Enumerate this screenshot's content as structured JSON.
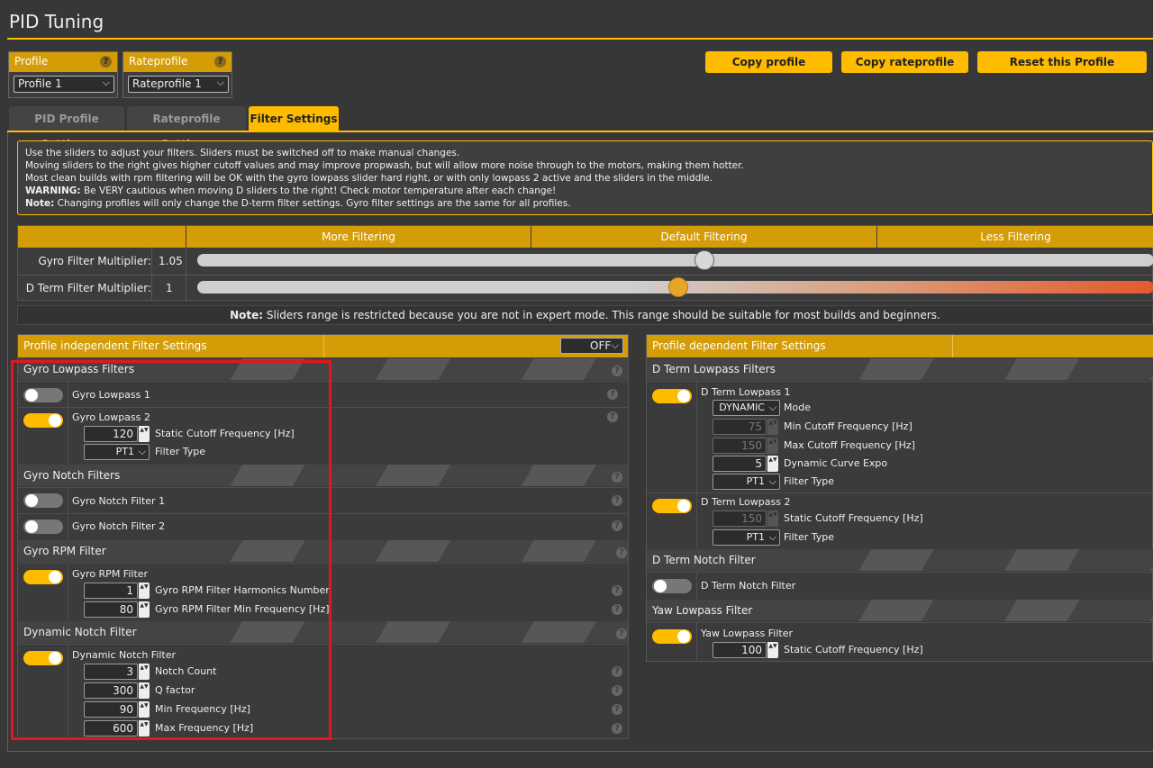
{
  "page_title": "PID Tuning",
  "profile": {
    "label": "Profile",
    "value": "Profile 1"
  },
  "rateprofile": {
    "label": "Rateprofile",
    "value": "Rateprofile 1"
  },
  "buttons": {
    "copy_profile": "Copy profile",
    "copy_rateprofile": "Copy rateprofile",
    "reset_profile": "Reset this Profile"
  },
  "tabs": [
    "PID Profile Settings",
    "Rateprofile Settings",
    "Filter Settings"
  ],
  "note": {
    "line1": "Use the sliders to adjust your filters. Sliders must be switched off to make manual changes.",
    "line2": "Moving sliders to the right gives higher cutoff values and may improve propwash, but will allow more noise through to the motors, making them hotter.",
    "line3": "Most clean builds with rpm filtering will be OK with the gyro lowpass slider hard right, or with only lowpass 2 active and the sliders in the middle.",
    "line4_bold": "WARNING:",
    "line4": " Be VERY cautious when moving D sliders to the right! Check motor temperature after each change!",
    "line5_bold": "Note:",
    "line5": " Changing profiles will only change the D-term filter settings. Gyro filter settings are the same for all profiles."
  },
  "sliders": {
    "headers": [
      "More Filtering",
      "Default Filtering",
      "Less Filtering"
    ],
    "gyro": {
      "label": "Gyro Filter Multiplier:",
      "value": "1.05",
      "position": 0.53
    },
    "dterm": {
      "label": "D Term Filter Multiplier:",
      "value": "1",
      "position": 0.5
    }
  },
  "restrict_note": {
    "bold": "Note:",
    "text": " Sliders range is restricted because you are not in expert mode. This range should be suitable for most builds and beginners."
  },
  "left_panel": {
    "title": "Profile independent Filter Settings",
    "mode": "OFF",
    "gyro_lowpass": {
      "title": "Gyro Lowpass Filters",
      "lp1": "Gyro Lowpass 1",
      "lp2": "Gyro Lowpass 2",
      "lp2_cutoff": "120",
      "lp2_cutoff_label": "Static Cutoff Frequency [Hz]",
      "lp2_type": "PT1",
      "lp2_type_label": "Filter Type"
    },
    "gyro_notch": {
      "title": "Gyro Notch Filters",
      "n1": "Gyro Notch Filter 1",
      "n2": "Gyro Notch Filter 2"
    },
    "gyro_rpm": {
      "title": "Gyro RPM Filter",
      "label": "Gyro RPM Filter",
      "harmonics": "1",
      "harmonics_label": "Gyro RPM Filter Harmonics Number",
      "minfreq": "80",
      "minfreq_label": "Gyro RPM Filter Min Frequency [Hz]"
    },
    "dyn_notch": {
      "title": "Dynamic Notch Filter",
      "label": "Dynamic Notch Filter",
      "count": "3",
      "count_label": "Notch Count",
      "q": "300",
      "q_label": "Q factor",
      "min": "90",
      "min_label": "Min Frequency [Hz]",
      "max": "600",
      "max_label": "Max Frequency [Hz]"
    }
  },
  "right_panel": {
    "title": "Profile dependent Filter Settings",
    "dterm_lowpass": {
      "title": "D Term Lowpass Filters",
      "lp1": "D Term Lowpass 1",
      "mode": "DYNAMIC",
      "mode_label": "Mode",
      "min": "75",
      "min_label": "Min Cutoff Frequency [Hz]",
      "max": "150",
      "max_label": "Max Cutoff Frequency [Hz]",
      "expo": "5",
      "expo_label": "Dynamic Curve Expo",
      "type": "PT1",
      "type_label": "Filter Type",
      "lp2": "D Term Lowpass 2",
      "lp2_cutoff": "150",
      "lp2_cutoff_label": "Static Cutoff Frequency [Hz]",
      "lp2_type": "PT1",
      "lp2_type_label": "Filter Type"
    },
    "dterm_notch": {
      "title": "D Term Notch Filter",
      "label": "D Term Notch Filter"
    },
    "yaw_lowpass": {
      "title": "Yaw Lowpass Filter",
      "label": "Yaw Lowpass Filter",
      "cutoff": "100",
      "cutoff_label": "Static Cutoff Frequency [Hz]"
    }
  },
  "icons": {
    "help": "?",
    "chevron": "⌵",
    "spinner": "▲▼"
  },
  "colors": {
    "accent": "#ffbb00",
    "header": "#d49c07",
    "highlight_box": "#e8141d"
  }
}
